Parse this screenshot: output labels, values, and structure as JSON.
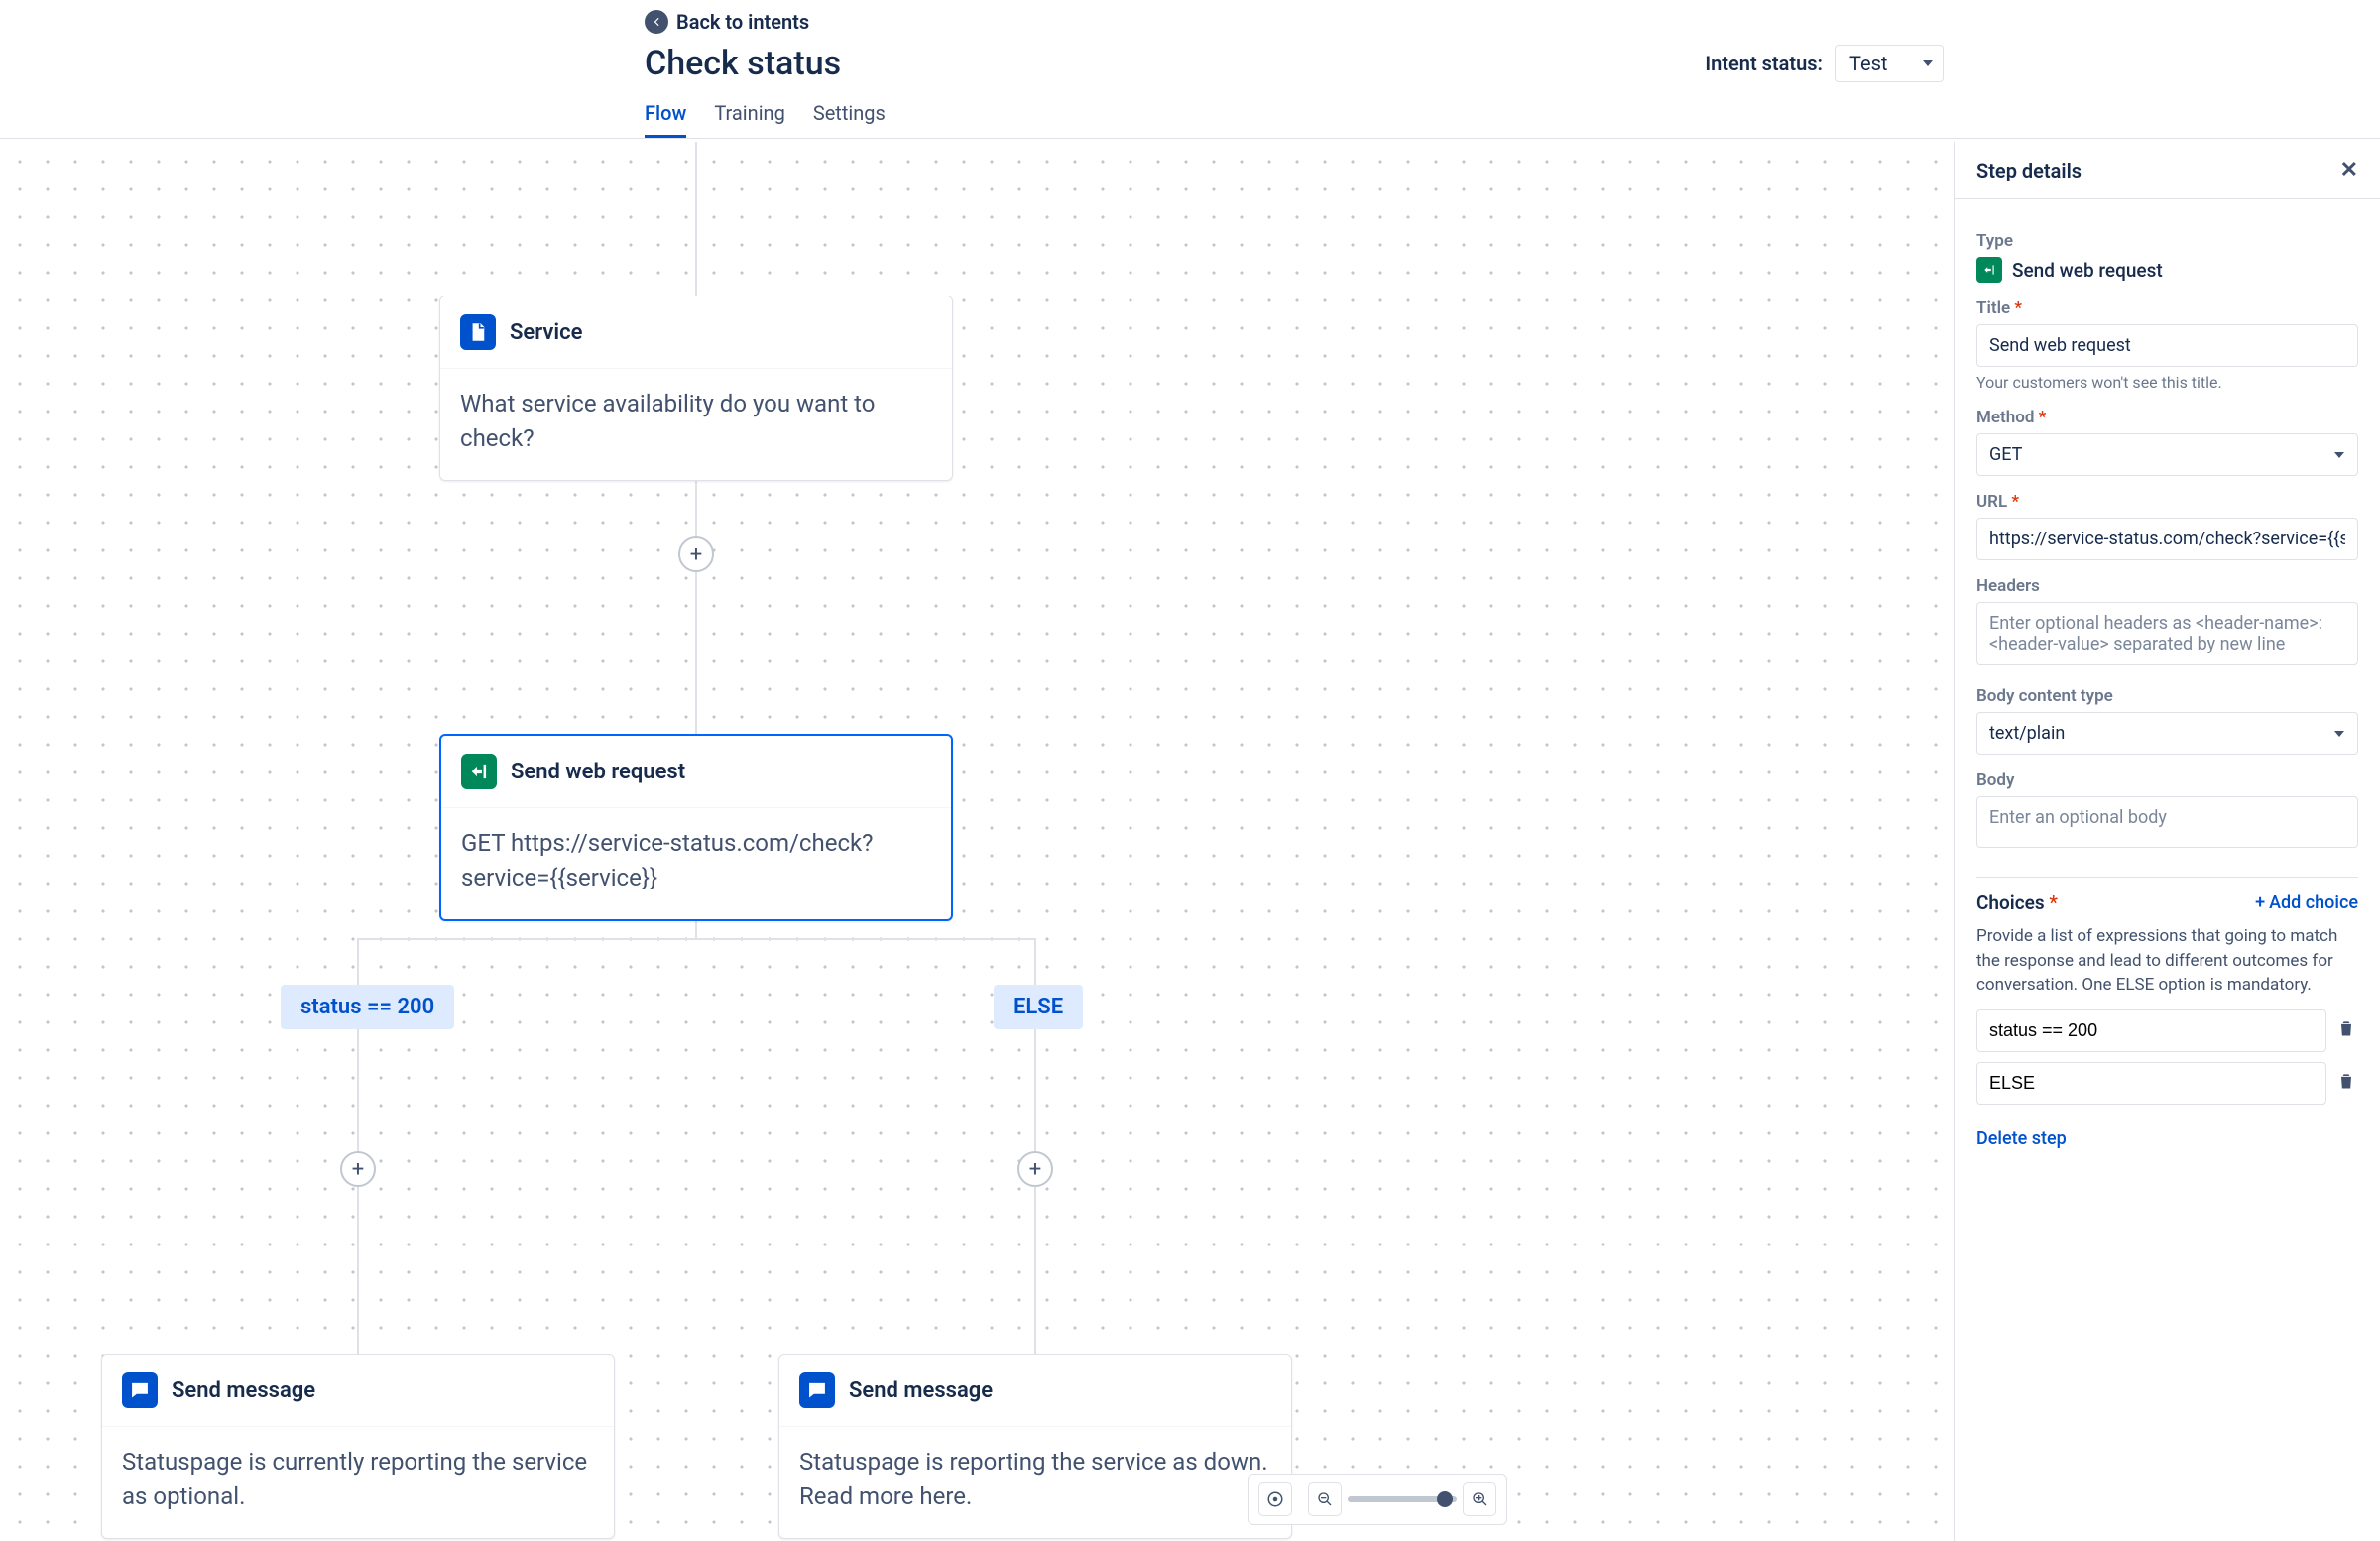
{
  "header": {
    "back_label": "Back to intents",
    "title": "Check status",
    "status_label": "Intent status:",
    "status_value": "Test",
    "tabs": [
      "Flow",
      "Training",
      "Settings"
    ],
    "active_tab": "Flow"
  },
  "canvas": {
    "nodes": {
      "service": {
        "title": "Service",
        "body": "What service availability do you want to check?"
      },
      "web_request": {
        "title": "Send web request",
        "body": "GET https://service-status.com/check?service={{service}}"
      },
      "msg_up": {
        "title": "Send message",
        "body": "Statuspage is currently reporting the service as optional."
      },
      "msg_down": {
        "title": "Send message",
        "body": "Statuspage is reporting the service as down. Read more here."
      }
    },
    "branches": {
      "left": "status == 200",
      "right": "ELSE"
    }
  },
  "panel": {
    "header": "Step details",
    "type_label": "Type",
    "type_value": "Send web request",
    "title_label": "Title",
    "title_value": "Send web request",
    "title_help": "Your customers won't see this title.",
    "method_label": "Method",
    "method_value": "GET",
    "url_label": "URL",
    "url_value": "https://service-status.com/check?service={{service}}",
    "headers_label": "Headers",
    "headers_placeholder": "Enter optional headers as <header-name>: <header-value> separated by new line",
    "bodytype_label": "Body content type",
    "bodytype_value": "text/plain",
    "body_label": "Body",
    "body_placeholder": "Enter an optional body",
    "choices_label": "Choices",
    "add_choice": "Add choice",
    "choices_desc": "Provide a list of expressions that going to match the response and lead to different outcomes for conversation. One ELSE option is mandatory.",
    "choices": [
      "status == 200",
      "ELSE"
    ],
    "delete_step": "Delete step"
  }
}
